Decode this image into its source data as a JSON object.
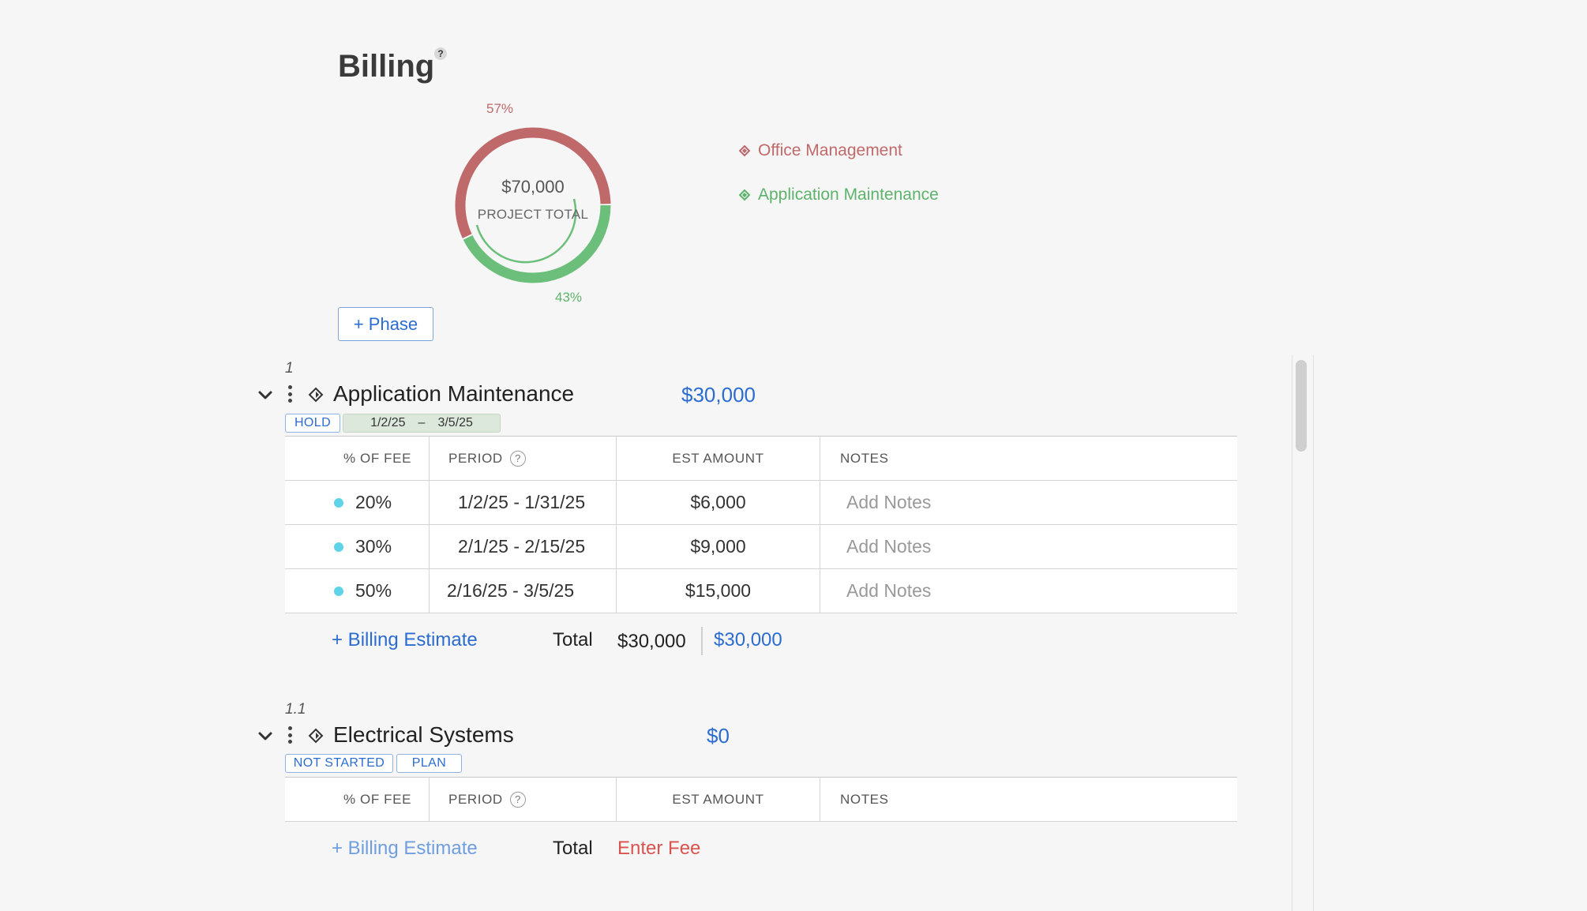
{
  "page": {
    "title": "Billing",
    "help": "?"
  },
  "donut": {
    "total": "$70,000",
    "subtitle": "PROJECT TOTAL",
    "segments": [
      {
        "name": "Office Management",
        "percent_label": "57%",
        "fraction": 0.57,
        "color": "#c0696b"
      },
      {
        "name": "Application Maintenance",
        "percent_label": "43%",
        "fraction": 0.43,
        "color": "#6cbf7a"
      }
    ]
  },
  "legend": [
    {
      "label": "Office Management",
      "color": "#c0696b"
    },
    {
      "label": "Application Maintenance",
      "color": "#5db36b"
    }
  ],
  "add_phase_label": "+ Phase",
  "columns": {
    "fee": "% OF FEE",
    "period": "PERIOD",
    "amount": "EST AMOUNT",
    "notes": "NOTES",
    "help": "?"
  },
  "phases": [
    {
      "number": "1",
      "name": "Application Maintenance",
      "amount": "$30,000",
      "tags": [
        "HOLD"
      ],
      "date_start": "1/2/25",
      "date_sep": "–",
      "date_end": "3/5/25",
      "rows": [
        {
          "fee": "20%",
          "period": "1/2/25 - 1/31/25",
          "amount": "$6,000",
          "notes": "Add Notes"
        },
        {
          "fee": "30%",
          "period": "2/1/25 - 2/15/25",
          "amount": "$9,000",
          "notes": "Add Notes"
        },
        {
          "fee": "50%",
          "period": "2/16/25 - 3/5/25",
          "amount": "$15,000",
          "notes": "Add Notes"
        }
      ],
      "add_estimate": "+ Billing Estimate",
      "total_label": "Total",
      "total_value": "$30,000",
      "total_budget": "$30,000"
    },
    {
      "number": "1.1",
      "name": "Electrical Systems",
      "amount": "$0",
      "tags": [
        "NOT STARTED",
        "PLAN"
      ],
      "rows": [],
      "add_estimate": "+ Billing Estimate",
      "total_label": "Total",
      "total_value": "Enter Fee"
    }
  ]
}
